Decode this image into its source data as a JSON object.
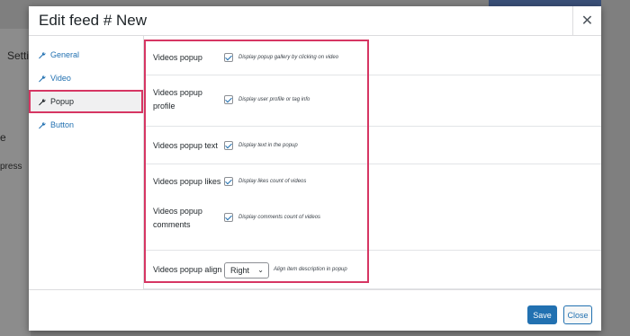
{
  "background": {
    "top_button_text": "",
    "side_text_1": "Setti",
    "side_text_2": "e",
    "side_text_3": "press"
  },
  "modal": {
    "title": "Edit feed # New",
    "close_symbol": "✕"
  },
  "sidebar": {
    "items": [
      {
        "label": "General",
        "icon": "wrench-icon"
      },
      {
        "label": "Video",
        "icon": "wrench-icon"
      },
      {
        "label": "Popup",
        "icon": "wrench-icon",
        "active": true
      },
      {
        "label": "Button",
        "icon": "wrench-icon"
      }
    ]
  },
  "settings": {
    "rows": [
      {
        "label": "Videos popup",
        "description": "Display popup gallery by clicking on video",
        "checked": true
      },
      {
        "label_line1": "Videos popup",
        "label_line2": "profile",
        "description": "Display user profile or tag info",
        "checked": true
      },
      {
        "label": "Videos popup text",
        "description": "Display text in the popup",
        "checked": true
      },
      {
        "label": "Videos popup likes",
        "description": "Display likes count of videos",
        "checked": true
      },
      {
        "label_line1": "Videos popup",
        "label_line2": "comments",
        "description": "Display comments count of videos",
        "checked": true
      },
      {
        "label": "Videos popup align",
        "select_value": "Right",
        "description": "Align item description in popup"
      }
    ]
  },
  "footer": {
    "save_label": "Save",
    "close_label": "Close"
  },
  "colors": {
    "accent": "#2271b1",
    "highlight": "#d63663"
  }
}
